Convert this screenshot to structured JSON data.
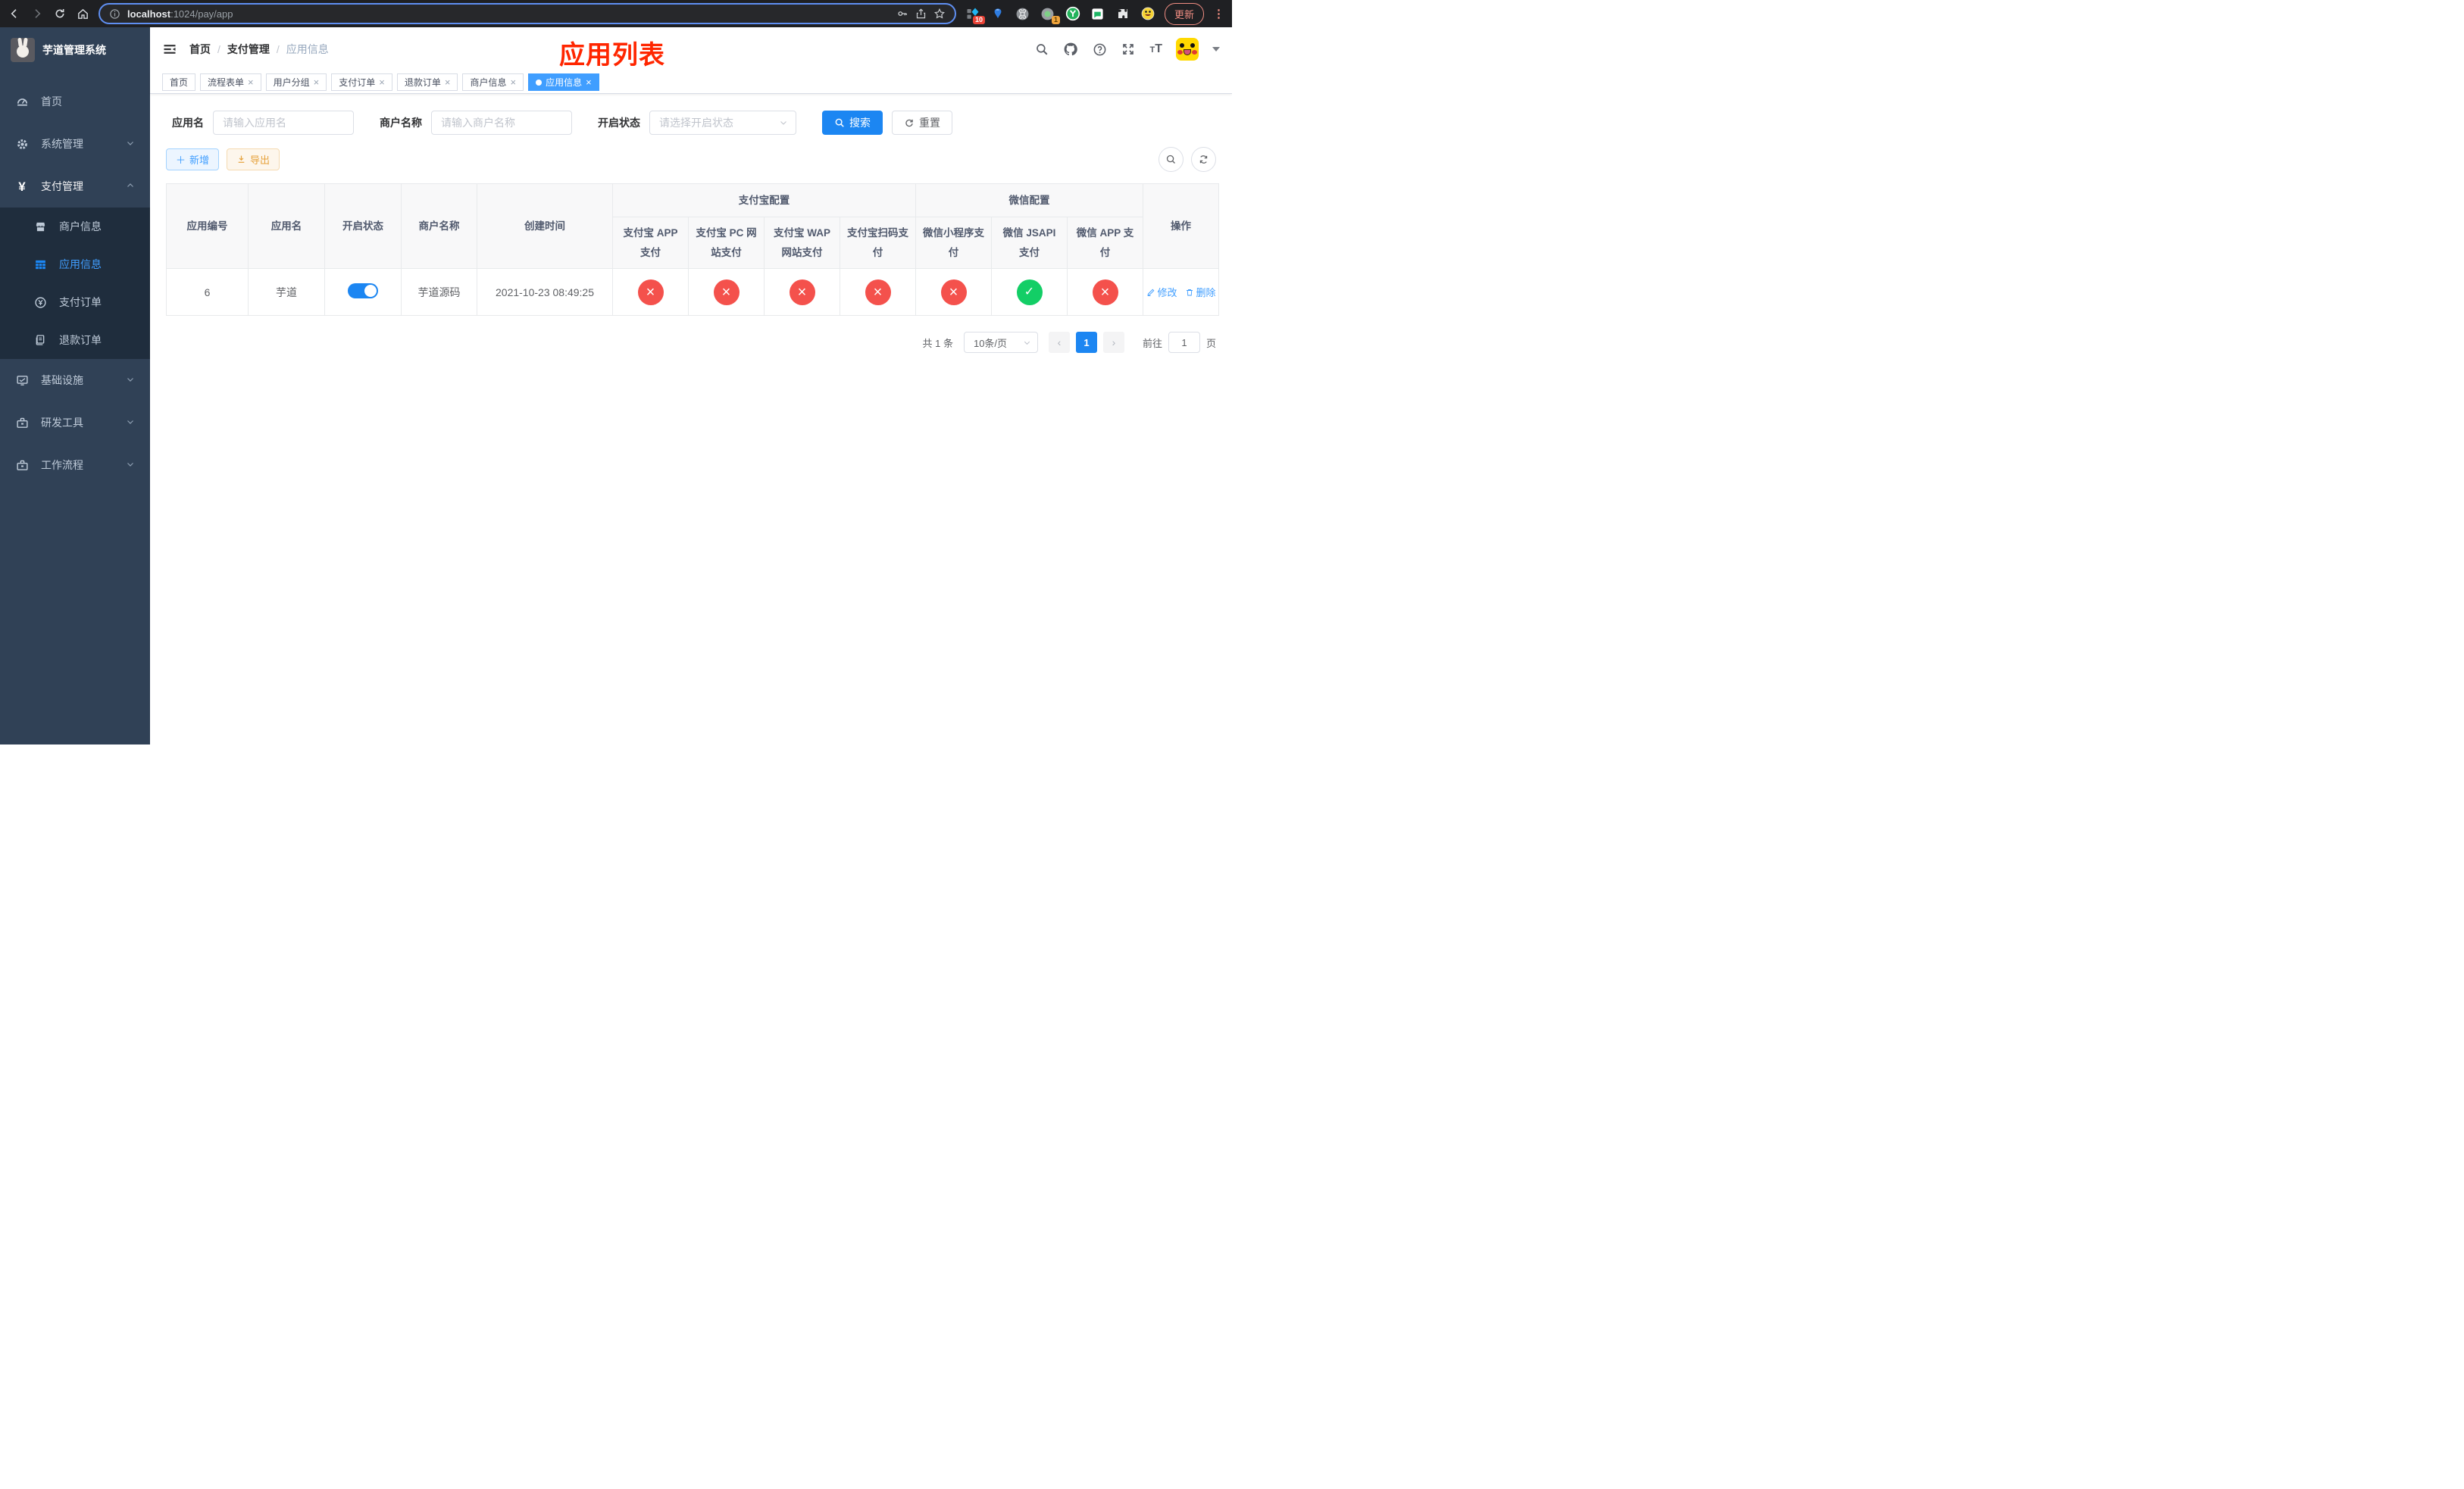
{
  "browser": {
    "url_host": "localhost",
    "url_path": ":1024/pay/app",
    "update_label": "更新",
    "ext_badge_blue": "10",
    "ext_badge_circle": "1"
  },
  "sidebar": {
    "title": "芋道管理系统",
    "menu": [
      {
        "label": "首页"
      },
      {
        "label": "系统管理"
      },
      {
        "label": "支付管理"
      },
      {
        "label": "基础设施"
      },
      {
        "label": "研发工具"
      },
      {
        "label": "工作流程"
      }
    ],
    "submenu": [
      {
        "label": "商户信息"
      },
      {
        "label": "应用信息"
      },
      {
        "label": "支付订单"
      },
      {
        "label": "退款订单"
      }
    ]
  },
  "navbar": {
    "breadcrumb": {
      "items": [
        "首页",
        "支付管理",
        "应用信息"
      ],
      "sep": "/"
    },
    "annotation": "应用列表"
  },
  "tags": [
    {
      "label": "首页"
    },
    {
      "label": "流程表单"
    },
    {
      "label": "用户分组"
    },
    {
      "label": "支付订单"
    },
    {
      "label": "退款订单"
    },
    {
      "label": "商户信息"
    },
    {
      "label": "应用信息"
    }
  ],
  "filters": {
    "app_name_label": "应用名",
    "app_name_placeholder": "请输入应用名",
    "merchant_label": "商户名称",
    "merchant_placeholder": "请输入商户名称",
    "status_label": "开启状态",
    "status_placeholder": "请选择开启状态",
    "search_label": "搜索",
    "reset_label": "重置"
  },
  "toolbar": {
    "add_label": "新增",
    "export_label": "导出"
  },
  "table": {
    "col_id": "应用编号",
    "col_name": "应用名",
    "col_status": "开启状态",
    "col_merchant": "商户名称",
    "col_created": "创建时间",
    "group_alipay": "支付宝配置",
    "group_wechat": "微信配置",
    "col_actions": "操作",
    "sub_cols": [
      "支付宝 APP 支付",
      "支付宝 PC 网站支付",
      "支付宝 WAP 网站支付",
      "支付宝扫码支付",
      "微信小程序支付",
      "微信 JSAPI 支付",
      "微信 APP 支付"
    ],
    "row": {
      "id": "6",
      "name": "芋道",
      "enabled": "on",
      "merchant": "芋道源码",
      "created": "2021-10-23 08:49:25",
      "configs": [
        "off",
        "off",
        "off",
        "off",
        "off",
        "on",
        "off"
      ],
      "edit_label": "修改",
      "delete_label": "删除"
    }
  },
  "pagination": {
    "total": "共 1 条",
    "page_size": "10条/页",
    "page": "1",
    "goto_label": "前往",
    "goto_value": "1",
    "unit_label": "页"
  },
  "colors": {
    "accent_blue": "#1c86f2",
    "soft_blue": "#409eff",
    "danger_red": "#f4514c",
    "success_green": "#13ce66",
    "warning_orange": "#e6a23c",
    "sidebar_bg": "#304156",
    "submenu_bg": "#1f2d3d",
    "annotation_red": "#ff2600"
  }
}
